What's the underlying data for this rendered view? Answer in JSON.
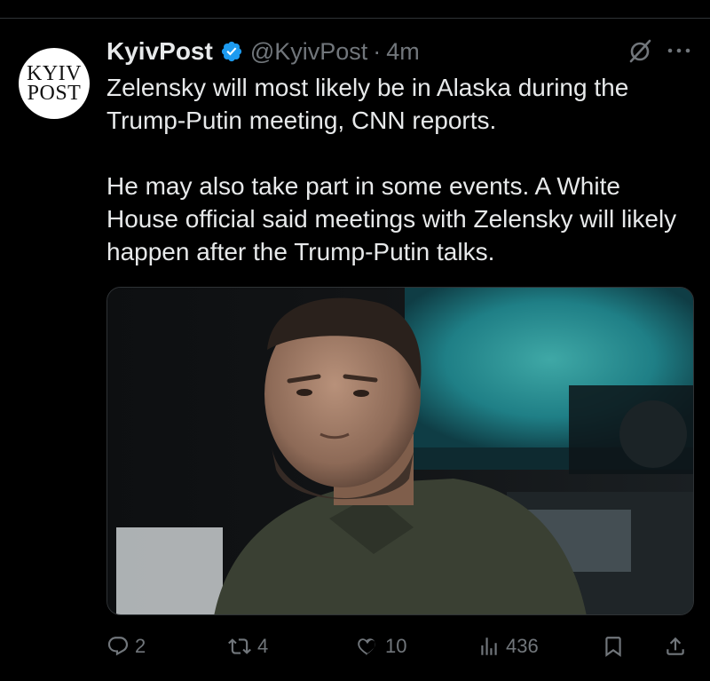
{
  "tweet": {
    "avatar_line1": "KYIV",
    "avatar_line2": "POST",
    "display_name": "KyivPost",
    "handle": "@KyivPost",
    "separator": "·",
    "timestamp": "4m",
    "paragraphs": [
      "Zelensky will most likely be in Alaska during the Trump-Putin meeting, CNN reports.",
      "He may also take part in some events. A White House official said meetings with Zelensky will likely happen after the Trump-Putin talks."
    ]
  },
  "actions": {
    "replies": "2",
    "reposts": "4",
    "likes": "10",
    "views": "436"
  },
  "colors": {
    "background": "#000000",
    "text_primary": "#e7e9ea",
    "text_secondary": "#71767b",
    "verified": "#1d9bf0"
  },
  "icons": {
    "verified": "verified-badge-icon",
    "grok": "grok-icon",
    "more": "more-icon",
    "reply": "reply-icon",
    "repost": "repost-icon",
    "like": "like-icon",
    "views": "views-icon",
    "bookmark": "bookmark-icon",
    "share": "share-icon"
  }
}
